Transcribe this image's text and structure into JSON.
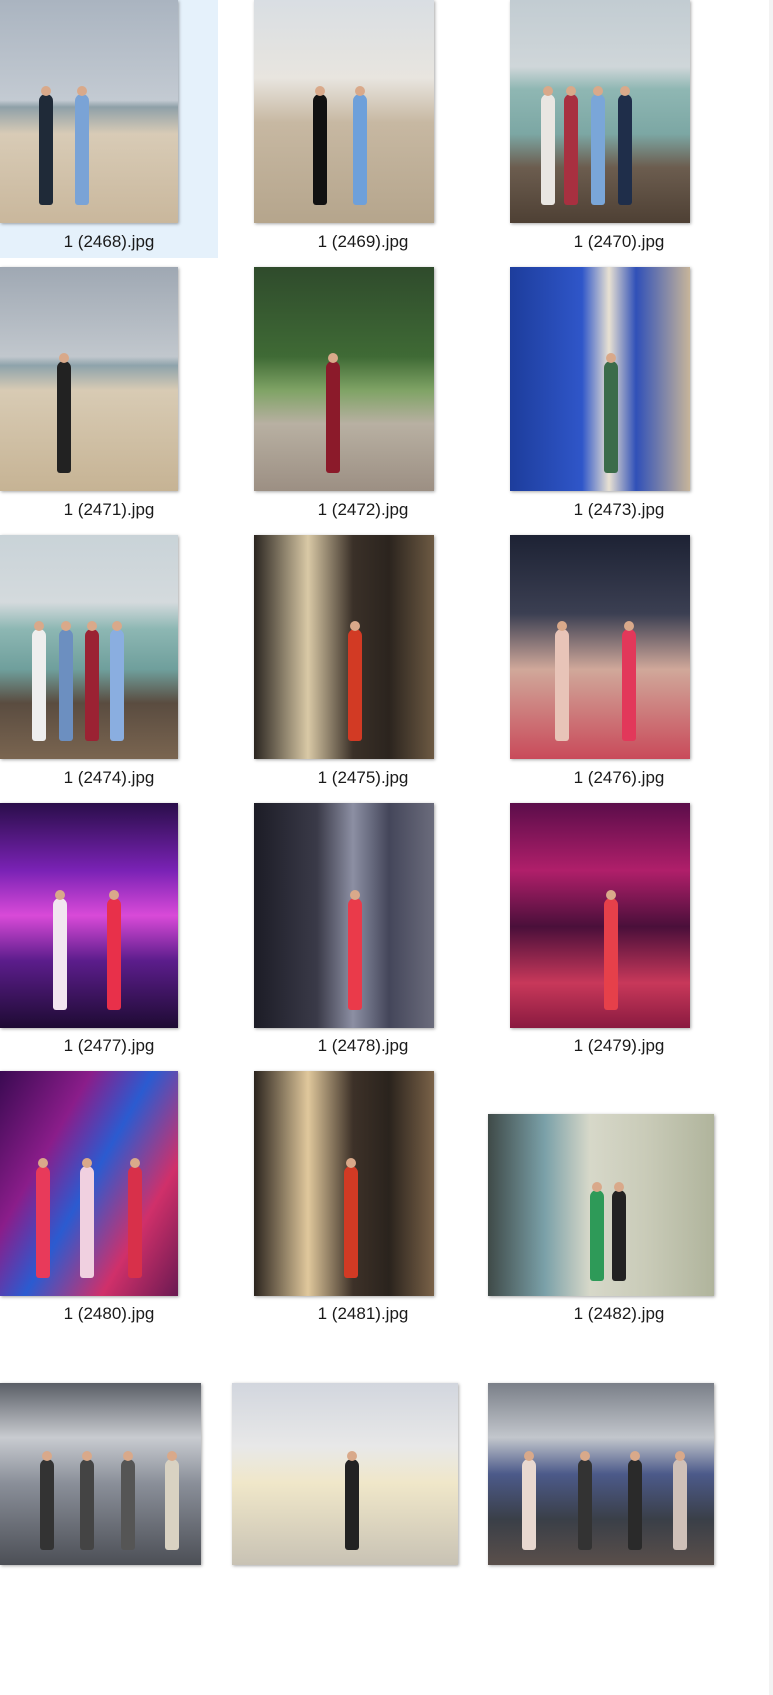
{
  "files": [
    {
      "name": "1 (2468).jpg",
      "selected": true,
      "scene": "beach-railing"
    },
    {
      "name": "1 (2469).jpg",
      "selected": false,
      "scene": "hotel-deckchairs"
    },
    {
      "name": "1 (2470).jpg",
      "selected": false,
      "scene": "harbor-group"
    },
    {
      "name": "1 (2471).jpg",
      "selected": false,
      "scene": "beach-walk"
    },
    {
      "name": "1 (2472).jpg",
      "selected": false,
      "scene": "garden-mosaic"
    },
    {
      "name": "1 (2473).jpg",
      "selected": false,
      "scene": "blue-mural"
    },
    {
      "name": "1 (2474).jpg",
      "selected": false,
      "scene": "harbor-family"
    },
    {
      "name": "1 (2475).jpg",
      "selected": false,
      "scene": "night-steps"
    },
    {
      "name": "1 (2476).jpg",
      "selected": false,
      "scene": "night-selfie"
    },
    {
      "name": "1 (2477).jpg",
      "selected": false,
      "scene": "club-lights"
    },
    {
      "name": "1 (2478).jpg",
      "selected": false,
      "scene": "city-street"
    },
    {
      "name": "1 (2479).jpg",
      "selected": false,
      "scene": "club-pink"
    },
    {
      "name": "1 (2480).jpg",
      "selected": false,
      "scene": "club-trio"
    },
    {
      "name": "1 (2481).jpg",
      "selected": false,
      "scene": "night-steps-2"
    },
    {
      "name": "1 (2482).jpg",
      "selected": false,
      "scene": "expo-podium"
    },
    {
      "name": "",
      "selected": false,
      "scene": "expo-hall"
    },
    {
      "name": "",
      "selected": false,
      "scene": "expo-booth"
    },
    {
      "name": "",
      "selected": false,
      "scene": "expo-crowd"
    }
  ]
}
